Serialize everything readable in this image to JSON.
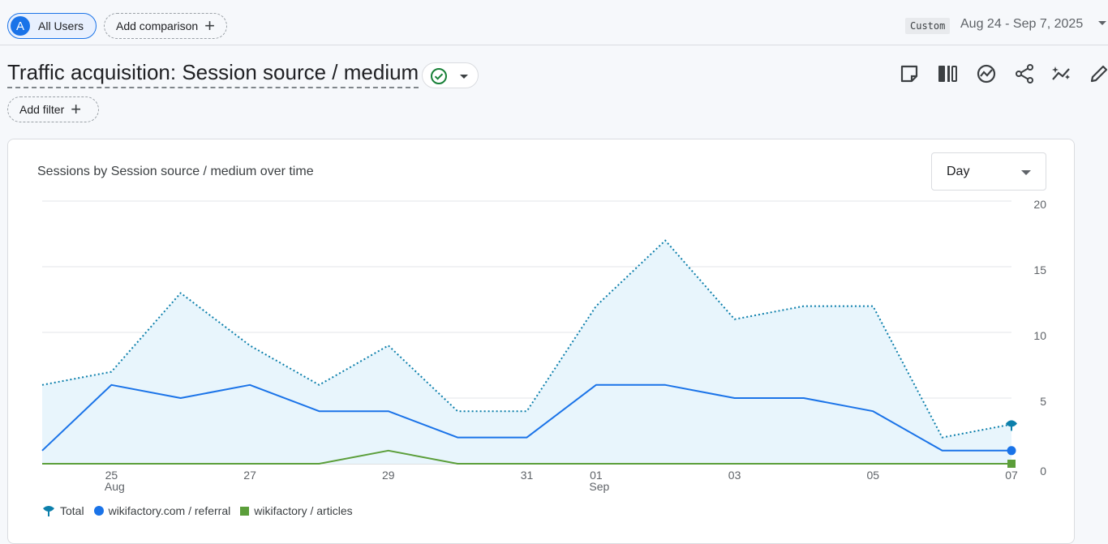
{
  "topbar": {
    "segment": {
      "avatar_letter": "A",
      "label": "All Users"
    },
    "comparison_label": "Add comparison",
    "date_badge": "Custom",
    "date_range": "Aug 24 - Sep 7, 2025"
  },
  "report": {
    "title": "Traffic acquisition: Session source / medium",
    "filter_label": "Add filter",
    "toolbar_icons": [
      "note-icon",
      "compare-columns-icon",
      "insights-icon",
      "share-icon",
      "trend-sparkle-icon",
      "edit-icon"
    ]
  },
  "card": {
    "granularity": "Day"
  },
  "colors": {
    "total": "#0c7fab",
    "referral": "#1a73e8",
    "articles": "#5b9e3a",
    "area_fill": "#e8f5fc"
  },
  "chart_data": {
    "type": "line",
    "title": "Sessions by Session source / medium over time",
    "x": [
      "2025-08-24",
      "2025-08-25",
      "2025-08-26",
      "2025-08-27",
      "2025-08-28",
      "2025-08-29",
      "2025-08-30",
      "2025-08-31",
      "2025-09-01",
      "2025-09-02",
      "2025-09-03",
      "2025-09-04",
      "2025-09-05",
      "2025-09-06",
      "2025-09-07"
    ],
    "x_ticks": [
      {
        "index": 1,
        "label": "25",
        "sublabel": "Aug"
      },
      {
        "index": 3,
        "label": "27",
        "sublabel": ""
      },
      {
        "index": 5,
        "label": "29",
        "sublabel": ""
      },
      {
        "index": 7,
        "label": "31",
        "sublabel": ""
      },
      {
        "index": 8,
        "label": "01",
        "sublabel": "Sep"
      },
      {
        "index": 10,
        "label": "03",
        "sublabel": ""
      },
      {
        "index": 12,
        "label": "05",
        "sublabel": ""
      },
      {
        "index": 14,
        "label": "07",
        "sublabel": ""
      }
    ],
    "y_ticks": [
      0,
      5,
      10,
      15,
      20
    ],
    "ylim": [
      0,
      20
    ],
    "legend_position": "bottom-left",
    "grid": true,
    "series": [
      {
        "name": "Total",
        "style": "dotted-area",
        "values": [
          6,
          7,
          13,
          9,
          6,
          9,
          4,
          4,
          12,
          17,
          11,
          12,
          12,
          2,
          3
        ]
      },
      {
        "name": "wikifactory.com / referral",
        "style": "solid",
        "values": [
          1,
          6,
          5,
          6,
          4,
          4,
          2,
          2,
          6,
          6,
          5,
          5,
          4,
          1,
          1
        ]
      },
      {
        "name": "wikifactory / articles",
        "style": "solid",
        "values": [
          0,
          0,
          0,
          0,
          0,
          1,
          0,
          0,
          0,
          0,
          0,
          0,
          0,
          0,
          0
        ]
      }
    ]
  }
}
